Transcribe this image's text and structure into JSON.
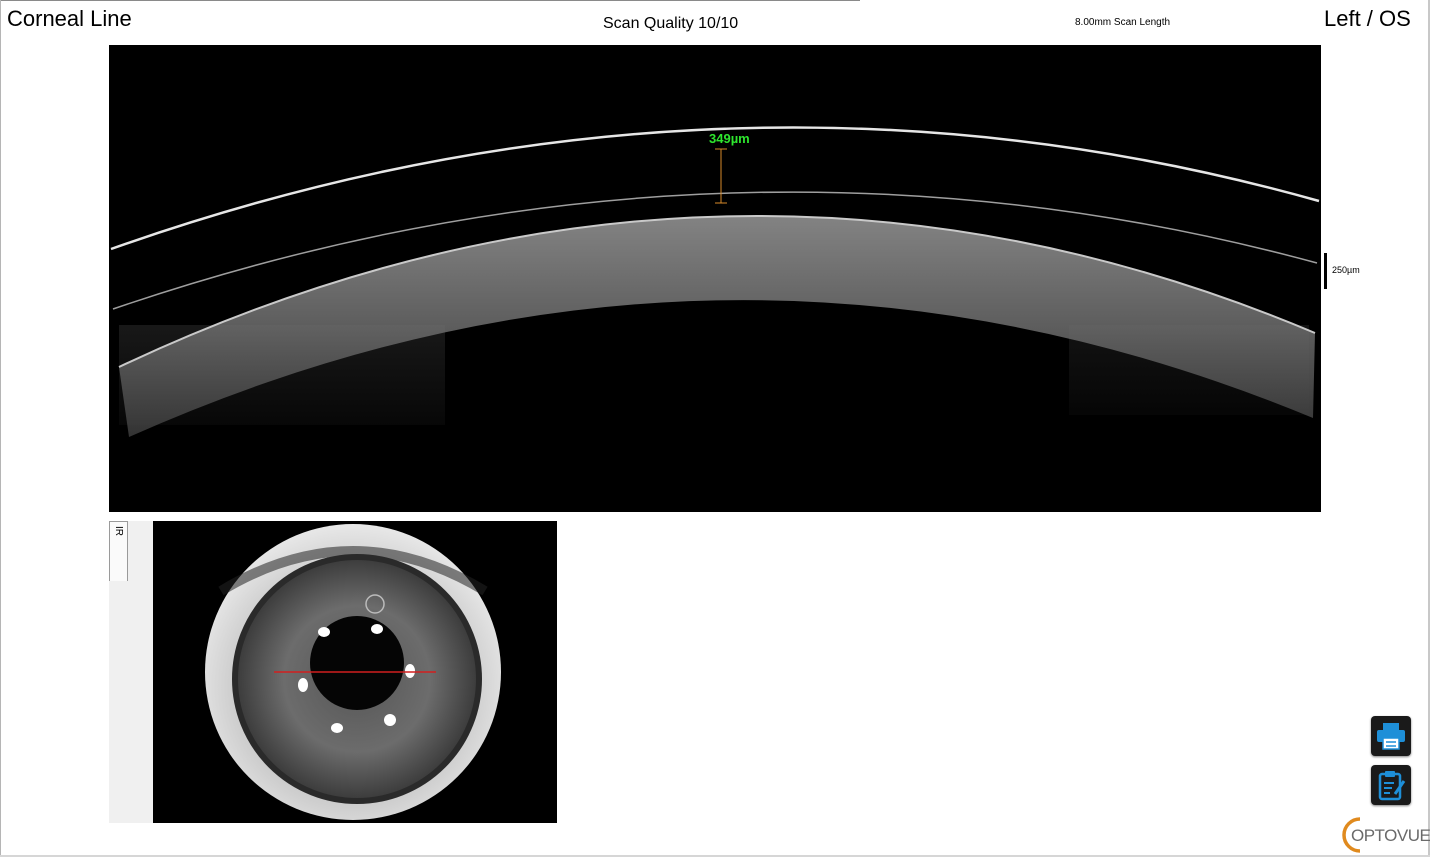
{
  "header": {
    "title": "Corneal Line",
    "scan_quality": "Scan Quality 10/10",
    "scan_length": "8.00mm Scan Length",
    "eye": "Left / OS"
  },
  "oct": {
    "measurement_label": "349µm",
    "scale_label": "250µm"
  },
  "ir": {
    "tab_label": "IR"
  },
  "toolbar": {
    "print_icon": "printer-icon",
    "report_icon": "clipboard-edit-icon"
  },
  "brand": {
    "logo_text": "OPTOVUE",
    "accent": "#1e8fd8",
    "logo_ring": "#e08a1e"
  }
}
